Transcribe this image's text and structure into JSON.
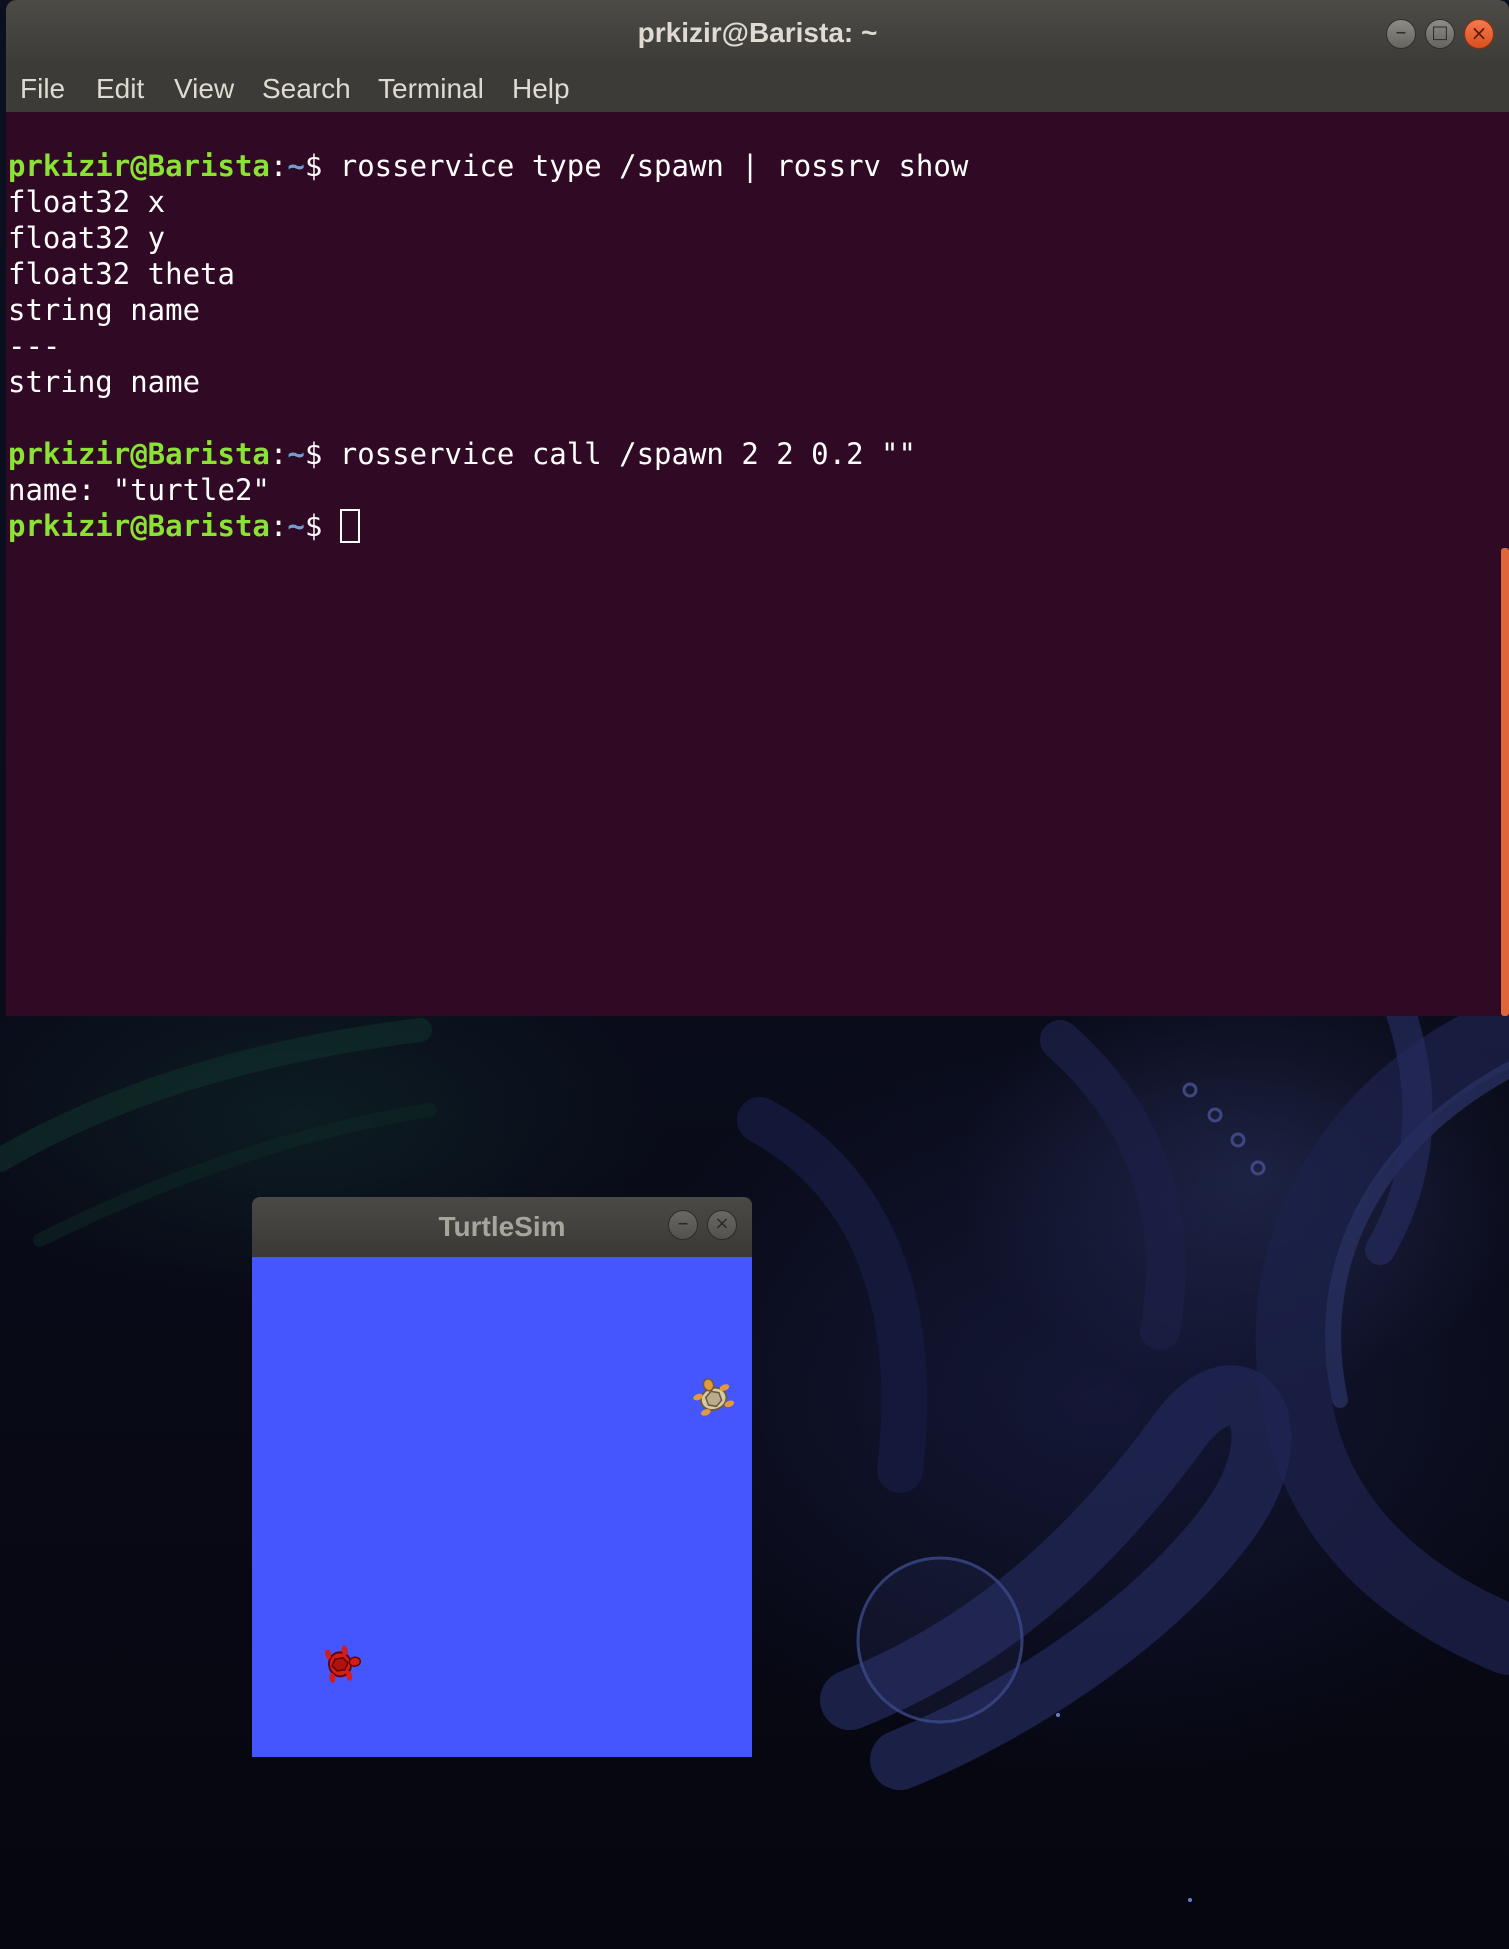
{
  "terminal": {
    "title": "prkizir@Barista: ~",
    "menu": [
      "File",
      "Edit",
      "View",
      "Search",
      "Terminal",
      "Help"
    ],
    "prompt": {
      "user_host": "prkizir@Barista",
      "separator": ":",
      "path": "~",
      "symbol": "$ "
    },
    "lines": [
      "",
      "rosservice type /spawn | rossrv show",
      "float32 x",
      "float32 y",
      "float32 theta",
      "string name",
      "---",
      "string name",
      "",
      "rosservice call /spawn 2 2 0.2 \"\"",
      "name: \"turtle2\"",
      ""
    ],
    "colors": {
      "background": "#300a24",
      "prompt_user": "#8ae234",
      "prompt_path": "#729fcf",
      "scroll_thumb": "#e0663a"
    }
  },
  "turtlesim": {
    "title": "TurtleSim",
    "background": "#4556ff",
    "turtles": [
      {
        "icon": "turtle1-icon",
        "color": "#d8c9a8"
      },
      {
        "icon": "turtle2-icon",
        "color": "#d41c1c"
      }
    ]
  },
  "window_controls": {
    "minimize": "–",
    "maximize": "□",
    "close": "×"
  }
}
